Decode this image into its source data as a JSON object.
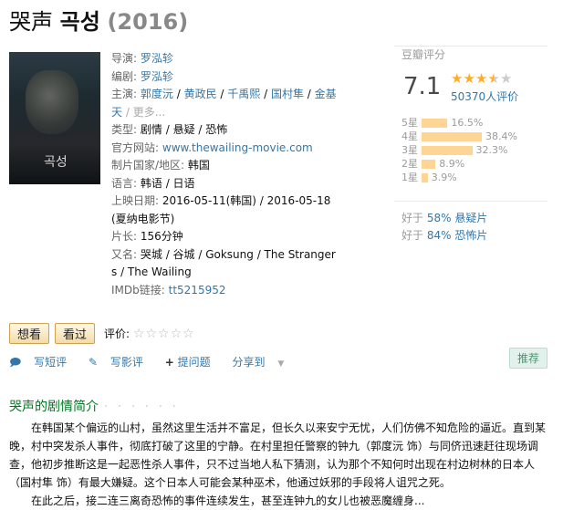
{
  "title": {
    "name": "哭声",
    "original": "곡성",
    "year": "(2016)"
  },
  "info": {
    "director_label": "导演:",
    "director": "罗泓轸",
    "writer_label": "编剧:",
    "writer": "罗泓轸",
    "cast_label": "主演:",
    "cast": [
      "郭度沅",
      "黄政民",
      "千禹熙",
      "国村隼",
      "金基天"
    ],
    "cast_more": "更多...",
    "genre_label": "类型:",
    "genres": [
      "剧情",
      "悬疑",
      "恐怖"
    ],
    "site_label": "官方网站:",
    "site": "www.thewailing-movie.com",
    "country_label": "制片国家/地区:",
    "country": "韩国",
    "language_label": "语言:",
    "language": "韩语 / 日语",
    "release_label": "上映日期:",
    "release_1": "2016-05-11(韩国)",
    "release_sep": " / ",
    "release_2": "2016-05-18(夏纳电影节)",
    "runtime_label": "片长:",
    "runtime": "156分钟",
    "aka_label": "又名:",
    "aka": "哭城 / 谷城 / Goksung / The Strangers / The Wailing",
    "imdb_label": "IMDb链接:",
    "imdb": "tt5215952"
  },
  "rating": {
    "label": "豆瓣评分",
    "score": "7.1",
    "stars_value": 3.5,
    "count": "50370人评价",
    "distribution": [
      {
        "star": "5星",
        "percent": "16.5%",
        "value": 16.5
      },
      {
        "star": "4星",
        "percent": "38.4%",
        "value": 38.4
      },
      {
        "star": "3星",
        "percent": "32.3%",
        "value": 32.3
      },
      {
        "star": "2星",
        "percent": "8.9%",
        "value": 8.9
      },
      {
        "star": "1星",
        "percent": "3.9%",
        "value": 3.9
      }
    ],
    "better_1_pre": "好于 ",
    "better_1_pct": "58%",
    "better_1_genre": "悬疑片",
    "better_2_pre": "好于 ",
    "better_2_pct": "84%",
    "better_2_genre": "恐怖片"
  },
  "buttons": {
    "want": "想看",
    "seen": "看过",
    "rate_label": "评价:"
  },
  "actions": {
    "short_review": "写短评",
    "review": "写影评",
    "question": "提问题",
    "share": "分享到"
  },
  "recommend": "推荐",
  "intro": {
    "heading": "哭声的剧情简介",
    "dots": "· · · · · ·",
    "p1": "在韩国某个偏远的山村，虽然这里生活并不富足，但长久以来安宁无忧，人们仿佛不知危险的逼近。直到某晚，村中突发杀人事件，彻底打破了这里的宁静。在村里担任警察的钟九（郭度沅 饰）与同侪迅速赶往现场调查，他初步推断这是一起恶性杀人事件，只不过当地人私下猜测，认为那个不知何时出现在村边树林的日本人（国村隼 饰）有最大嫌疑。这个日本人可能会某种巫术，他通过妖邪的手段将人诅咒之死。",
    "p2": "在此之后，接二连三离奇恐怖的事件连续发生，甚至连钟九的女儿也被恶魔缠身..."
  }
}
